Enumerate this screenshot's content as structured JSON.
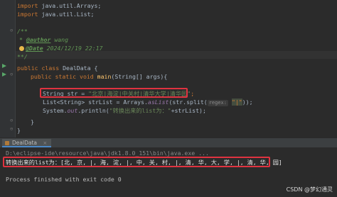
{
  "editor": {
    "imports": [
      "import java.util.Arrays;",
      "import java.util.List;"
    ],
    "javadoc_open": "/**",
    "javadoc_star": "*",
    "author_tag": "@auth",
    "author_tag_rest": "or",
    "author_value": " wang",
    "date_tag": "@Date",
    "date_value": " 2024/12/19 22:17",
    "javadoc_close": "**/",
    "class_decl_kw": "public class ",
    "class_name": "DealData {",
    "method_kw": "public static void ",
    "method_name": "main",
    "method_params": "(String[] args){",
    "line_str_pre": "String str = ",
    "line_str_value": "\"北京|海淀|中关村|清华大学|清华园\"",
    "line_str_post": ";",
    "line_list_pre": "List<String> strList = Arrays.",
    "line_list_method": "asList",
    "line_list_mid": "(str.split(",
    "regex_hint": "regex:",
    "line_list_arg": "\"|\"",
    "line_list_post": "));",
    "line_print_pre": "System.",
    "line_print_field": "out",
    "line_print_mid": ".println(",
    "line_print_str": "\"转换出来的list为：\"",
    "line_print_post": "+strList);",
    "close_brace_1": "}",
    "close_brace_2": "}"
  },
  "run_panel": {
    "tab_label": "DealData",
    "close_glyph": "×",
    "command_line": "D:\\eclipse-ide\\resource\\java\\jdk1.8.0_151\\bin\\java.exe ...",
    "output_line": "转换出来的list为：[北, 京, |, 海, 淀, |, 中, 关, 村, |, 清, 华, 大, 学, |, 清, 华, 园]",
    "finished_line": "Process finished with exit code 0"
  },
  "watermark": "CSDN @梦幻通灵",
  "colors": {
    "editor_bg": "#2b2b2b",
    "keyword": "#cc7832",
    "string": "#6a8759",
    "highlight_box": "#e03340"
  }
}
